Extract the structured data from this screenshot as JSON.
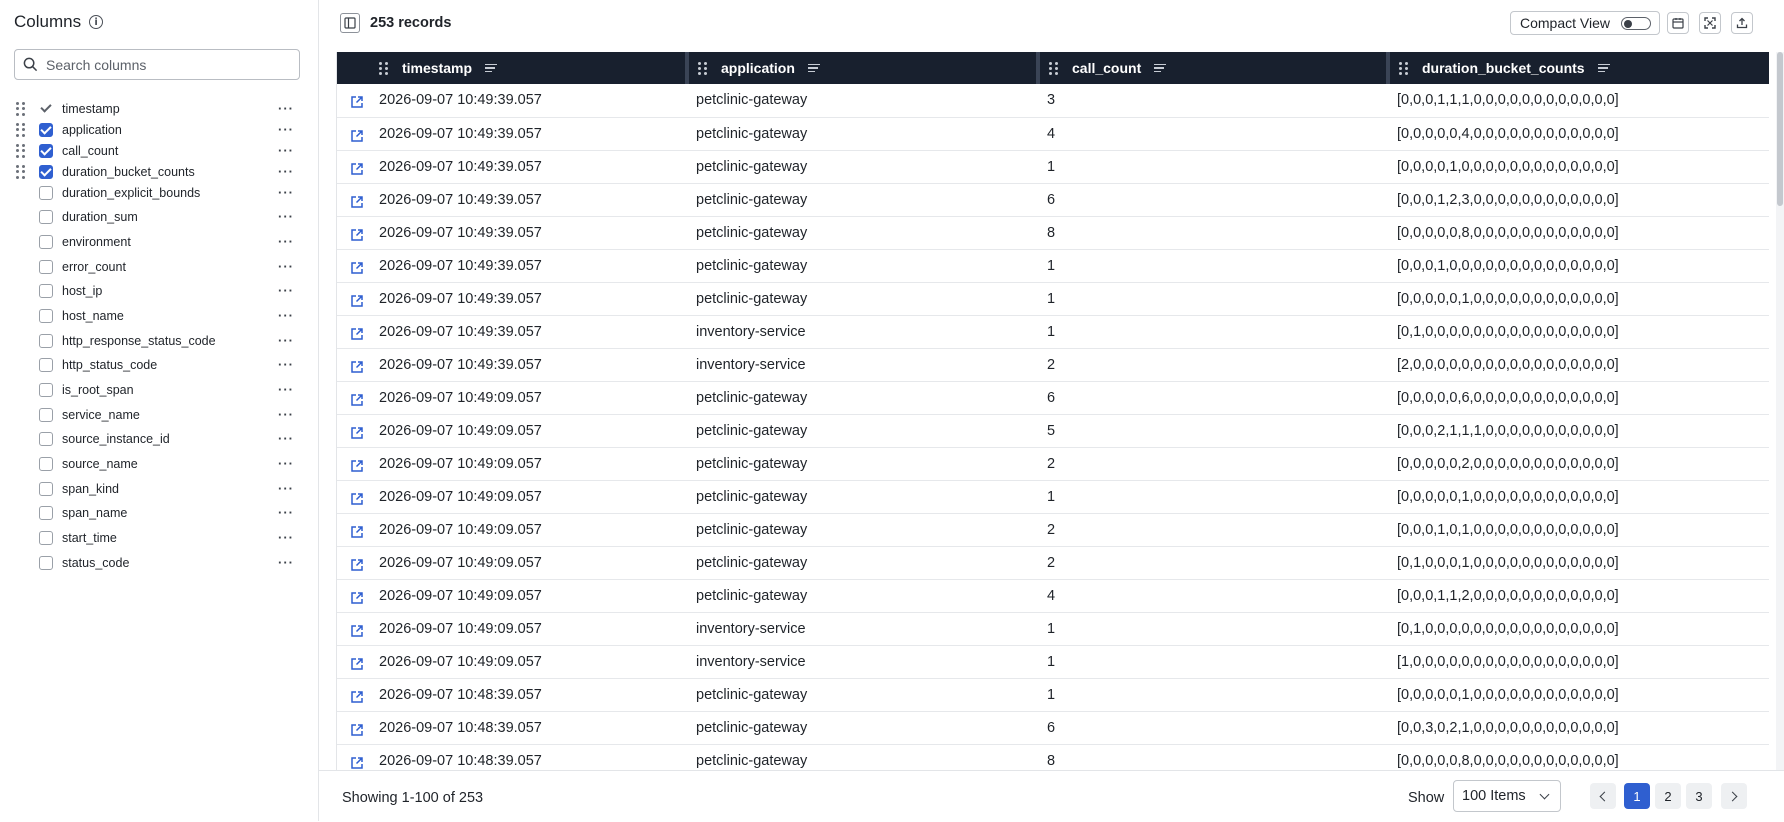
{
  "sidebar": {
    "title": "Columns",
    "search_placeholder": "Search columns",
    "columns": [
      {
        "name": "timestamp",
        "state": "locked"
      },
      {
        "name": "application",
        "state": "checked"
      },
      {
        "name": "call_count",
        "state": "checked"
      },
      {
        "name": "duration_bucket_counts",
        "state": "checked"
      },
      {
        "name": "duration_explicit_bounds",
        "state": "unchecked"
      },
      {
        "name": "duration_sum",
        "state": "unchecked"
      },
      {
        "name": "environment",
        "state": "unchecked"
      },
      {
        "name": "error_count",
        "state": "unchecked"
      },
      {
        "name": "host_ip",
        "state": "unchecked"
      },
      {
        "name": "host_name",
        "state": "unchecked"
      },
      {
        "name": "http_response_status_code",
        "state": "unchecked"
      },
      {
        "name": "http_status_code",
        "state": "unchecked"
      },
      {
        "name": "is_root_span",
        "state": "unchecked"
      },
      {
        "name": "service_name",
        "state": "unchecked"
      },
      {
        "name": "source_instance_id",
        "state": "unchecked"
      },
      {
        "name": "source_name",
        "state": "unchecked"
      },
      {
        "name": "span_kind",
        "state": "unchecked"
      },
      {
        "name": "span_name",
        "state": "unchecked"
      },
      {
        "name": "start_time",
        "state": "unchecked"
      },
      {
        "name": "status_code",
        "state": "unchecked"
      }
    ]
  },
  "toolbar": {
    "records": "253 records",
    "compact_view_label": "Compact View"
  },
  "table": {
    "headers": [
      "timestamp",
      "application",
      "call_count",
      "duration_bucket_counts"
    ],
    "rows": [
      [
        "2026-09-07 10:49:39.057",
        "petclinic-gateway",
        "3",
        "[0,0,0,1,1,1,0,0,0,0,0,0,0,0,0,0,0,0]"
      ],
      [
        "2026-09-07 10:49:39.057",
        "petclinic-gateway",
        "4",
        "[0,0,0,0,0,4,0,0,0,0,0,0,0,0,0,0,0,0]"
      ],
      [
        "2026-09-07 10:49:39.057",
        "petclinic-gateway",
        "1",
        "[0,0,0,0,1,0,0,0,0,0,0,0,0,0,0,0,0,0]"
      ],
      [
        "2026-09-07 10:49:39.057",
        "petclinic-gateway",
        "6",
        "[0,0,0,1,2,3,0,0,0,0,0,0,0,0,0,0,0,0]"
      ],
      [
        "2026-09-07 10:49:39.057",
        "petclinic-gateway",
        "8",
        "[0,0,0,0,0,8,0,0,0,0,0,0,0,0,0,0,0,0]"
      ],
      [
        "2026-09-07 10:49:39.057",
        "petclinic-gateway",
        "1",
        "[0,0,0,1,0,0,0,0,0,0,0,0,0,0,0,0,0,0]"
      ],
      [
        "2026-09-07 10:49:39.057",
        "petclinic-gateway",
        "1",
        "[0,0,0,0,0,1,0,0,0,0,0,0,0,0,0,0,0,0]"
      ],
      [
        "2026-09-07 10:49:39.057",
        "inventory-service",
        "1",
        "[0,1,0,0,0,0,0,0,0,0,0,0,0,0,0,0,0,0]"
      ],
      [
        "2026-09-07 10:49:39.057",
        "inventory-service",
        "2",
        "[2,0,0,0,0,0,0,0,0,0,0,0,0,0,0,0,0,0]"
      ],
      [
        "2026-09-07 10:49:09.057",
        "petclinic-gateway",
        "6",
        "[0,0,0,0,0,6,0,0,0,0,0,0,0,0,0,0,0,0]"
      ],
      [
        "2026-09-07 10:49:09.057",
        "petclinic-gateway",
        "5",
        "[0,0,0,2,1,1,1,0,0,0,0,0,0,0,0,0,0,0]"
      ],
      [
        "2026-09-07 10:49:09.057",
        "petclinic-gateway",
        "2",
        "[0,0,0,0,0,2,0,0,0,0,0,0,0,0,0,0,0,0]"
      ],
      [
        "2026-09-07 10:49:09.057",
        "petclinic-gateway",
        "1",
        "[0,0,0,0,0,1,0,0,0,0,0,0,0,0,0,0,0,0]"
      ],
      [
        "2026-09-07 10:49:09.057",
        "petclinic-gateway",
        "2",
        "[0,0,0,1,0,1,0,0,0,0,0,0,0,0,0,0,0,0]"
      ],
      [
        "2026-09-07 10:49:09.057",
        "petclinic-gateway",
        "2",
        "[0,1,0,0,0,1,0,0,0,0,0,0,0,0,0,0,0,0]"
      ],
      [
        "2026-09-07 10:49:09.057",
        "petclinic-gateway",
        "4",
        "[0,0,0,1,1,2,0,0,0,0,0,0,0,0,0,0,0,0]"
      ],
      [
        "2026-09-07 10:49:09.057",
        "inventory-service",
        "1",
        "[0,1,0,0,0,0,0,0,0,0,0,0,0,0,0,0,0,0]"
      ],
      [
        "2026-09-07 10:49:09.057",
        "inventory-service",
        "1",
        "[1,0,0,0,0,0,0,0,0,0,0,0,0,0,0,0,0,0]"
      ],
      [
        "2026-09-07 10:48:39.057",
        "petclinic-gateway",
        "1",
        "[0,0,0,0,0,1,0,0,0,0,0,0,0,0,0,0,0,0]"
      ],
      [
        "2026-09-07 10:48:39.057",
        "petclinic-gateway",
        "6",
        "[0,0,3,0,2,1,0,0,0,0,0,0,0,0,0,0,0,0]"
      ],
      [
        "2026-09-07 10:48:39.057",
        "petclinic-gateway",
        "8",
        "[0,0,0,0,0,8,0,0,0,0,0,0,0,0,0,0,0,0]"
      ]
    ]
  },
  "footer": {
    "showing": "Showing 1-100 of 253",
    "show_label": "Show",
    "page_size": "100 Items",
    "pages": [
      "1",
      "2",
      "3"
    ],
    "current_page": "1"
  }
}
